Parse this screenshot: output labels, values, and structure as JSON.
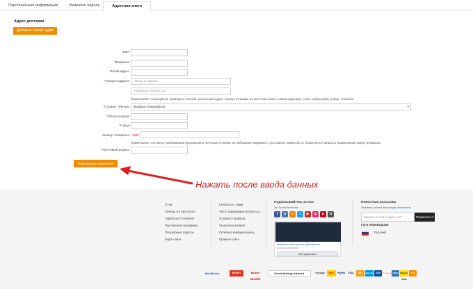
{
  "tabs": [
    "Персональная информация",
    "Изменить пароль",
    "Адресная книга"
  ],
  "section_title": "Адрес доставки",
  "add_address": "Добавить новый адрес",
  "form": {
    "name_label": "Имя",
    "surname_label": "Фамилия",
    "email_label": "Email-адрес",
    "street_label": "Улица в адресе",
    "street_placeholder": "Улица и, адресе",
    "apt_placeholder": "Квартира, блок (и т.д.)",
    "address_note": "Примечание: пожалуйста, приведите полный, детальный адрес страны отправки на местном языке: номер квартиры, этаж, номер дома, улица. Спасибо.",
    "country_label": "Страна / Регион",
    "country_value": "Выбрать пожалуйста",
    "region_label": "Область/Край",
    "city_label": "Город",
    "phone_label": "Номер телефона",
    "phone_prefix": "+000",
    "phone_note": "Примечание: Согласно требованиям курьерской и почтовой службы, во избежание задержек с доставкой, пожалуйста, пожалуйста написать правильный номер телефона.",
    "zip_label": "Почтовый индекс",
    "submit": "Подтвердить изменения"
  },
  "annotation": "Нажать после ввода данных",
  "footer": {
    "col1": [
      "О нас",
      "Почему это бесплатно",
      "Заработай с Gearbest",
      "Партнёрская программа",
      "Популярные запросы",
      "Карта сайта"
    ],
    "col2": [
      "Связаться с нами",
      "Часто задаваемые вопросы и...",
      "Условия и правила",
      "Гарантия и возврат",
      "Политика конфиденциаль...",
      "Правила сайте"
    ],
    "social_title": "Подписывайтесь на нас",
    "social_sub": "On Social Networks",
    "fb_title": "Новинки электроники. Доступные...",
    "fb_likes": "82 054 участников",
    "fb_button": "Вы подписаны",
    "newsletter_title": "Новостная рассылка",
    "newsletter_sub": "Gearbest узнают все",
    "newsletter_link": "скидки бесплатно",
    "email_placeholder": "Введите E-mail в адресе ТЕ",
    "subscribe": "Подписаться",
    "lang_title": "Гугл переводчик",
    "lang_value": "Русский"
  },
  "payments": [
    "WebMoney",
    "MONEY BACK",
    "McAfee SECURE",
    "ResellerRatings ★★★★★",
    "Verisign",
    "DHL",
    "PayPal",
    "VISA",
    "MC",
    "Maestro",
    "JCB",
    "Discover",
    "AMEX",
    "Western Union",
    "Qiwi"
  ]
}
